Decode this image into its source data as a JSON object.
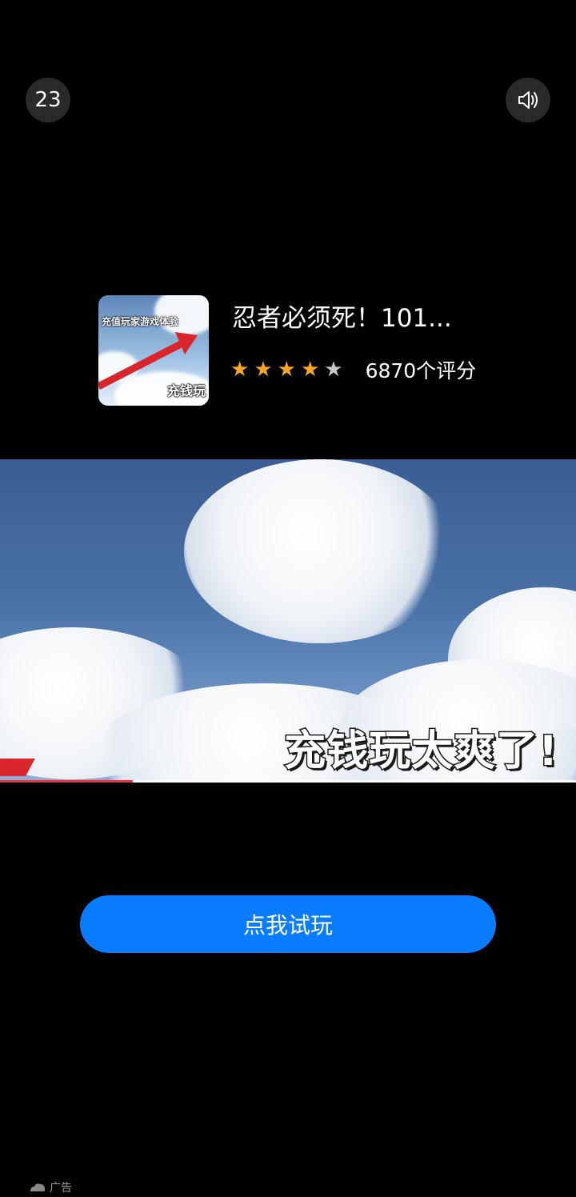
{
  "countdown": "23",
  "sound_icon": "speaker-volume-icon",
  "app": {
    "icon_text_top": "充值玩家游戏体验",
    "icon_text_bottom": "充钱玩",
    "title": "忍者必须死！101...",
    "rating": 4,
    "rating_max": 5,
    "rating_count": "6870个评分",
    "star_color": "#f6a623"
  },
  "video": {
    "caption": "充钱玩太爽了!",
    "progress": 0.23
  },
  "cta": {
    "label": "点我试玩",
    "color": "#0a7cff"
  },
  "ad": {
    "label": "广告",
    "icon": "cloud-logo-icon"
  }
}
